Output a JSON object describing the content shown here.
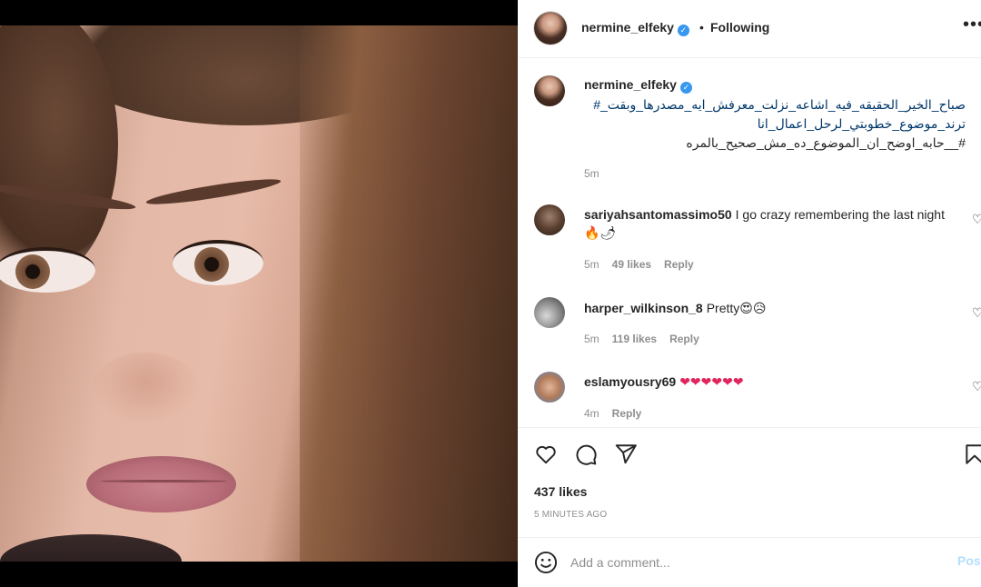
{
  "header": {
    "username": "nermine_elfeky",
    "separator": "•",
    "follow_status": "Following",
    "more_label": "•••"
  },
  "caption": {
    "username": "nermine_elfeky",
    "line1": "صباح_الخير_الحقيقه_فيه_اشاعه_نزلت_معرفش_ايه_مصدرها_وبقت_#",
    "line2": "ترند_موضوع_خطوبتي_لرحل_اعمال_انا",
    "line3": "#__حابه_اوضح_ان_الموضوع_ده_مش_صحيح_بالمره",
    "time": "5m"
  },
  "comments": [
    {
      "username": "sariyahsantomassimo50",
      "text": "I go crazy remembering the last night🔥🌶",
      "time": "5m",
      "likes": "49 likes",
      "reply": "Reply"
    },
    {
      "username": "harper_wilkinson_8",
      "text": "Pretty😍😥",
      "time": "5m",
      "likes": "119 likes",
      "reply": "Reply"
    },
    {
      "username": "eslamyousry69",
      "text": "❤❤❤❤❤❤",
      "time": "4m",
      "likes": "",
      "reply": "Reply"
    }
  ],
  "post": {
    "likes": "437 likes",
    "time_ago": "5 MINUTES AGO"
  },
  "comment_box": {
    "placeholder": "Add a comment...",
    "post_label": "Post"
  },
  "icons": [
    "verified-badge-icon",
    "more-options-icon",
    "heart-icon",
    "comment-icon",
    "share-icon",
    "bookmark-icon",
    "emoji-icon"
  ],
  "colors": {
    "verified": "#3897f0",
    "link": "#00376b",
    "muted": "#8e8e8e",
    "post_disabled": "#b2dffc"
  }
}
